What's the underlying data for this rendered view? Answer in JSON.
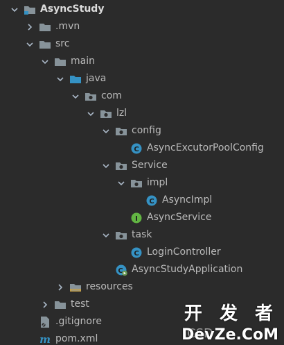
{
  "tree": {
    "project": "AsyncStudy",
    "mvn": ".mvn",
    "src": "src",
    "main": "main",
    "java": "java",
    "com": "com",
    "lzl": "lzl",
    "config": "config",
    "pool_config": "AsyncExcutorPoolConfig",
    "service": "Service",
    "impl": "impl",
    "async_impl": "AsyncImpl",
    "async_service": "AsyncService",
    "task": "task",
    "login_controller": "LoginController",
    "application": "AsyncStudyApplication",
    "resources": "resources",
    "test": "test",
    "gitignore": ".gitignore",
    "pom": "pom.xml"
  },
  "icons": {
    "folder": "folder-icon",
    "source_folder": "source-folder-icon",
    "package": "package-icon",
    "class": "class-icon",
    "interface": "interface-icon",
    "spring_app": "spring-boot-application-icon",
    "resources_folder": "resources-folder-icon",
    "gitignore": "gitignore-file-icon",
    "maven": "maven-icon",
    "arrow_expanded": "chevron-down-icon",
    "arrow_collapsed": "chevron-right-icon"
  },
  "colors": {
    "background": "#2b2b2b",
    "text": "#bbbbbb",
    "folder": "#87939a",
    "source_folder": "#3592c4",
    "class": "#3592c4",
    "interface": "#62b543",
    "spring": "#6a9955"
  },
  "watermark": {
    "cn": "开 发 者",
    "csdn": "CSD",
    "en": "DevZe.CoM"
  }
}
